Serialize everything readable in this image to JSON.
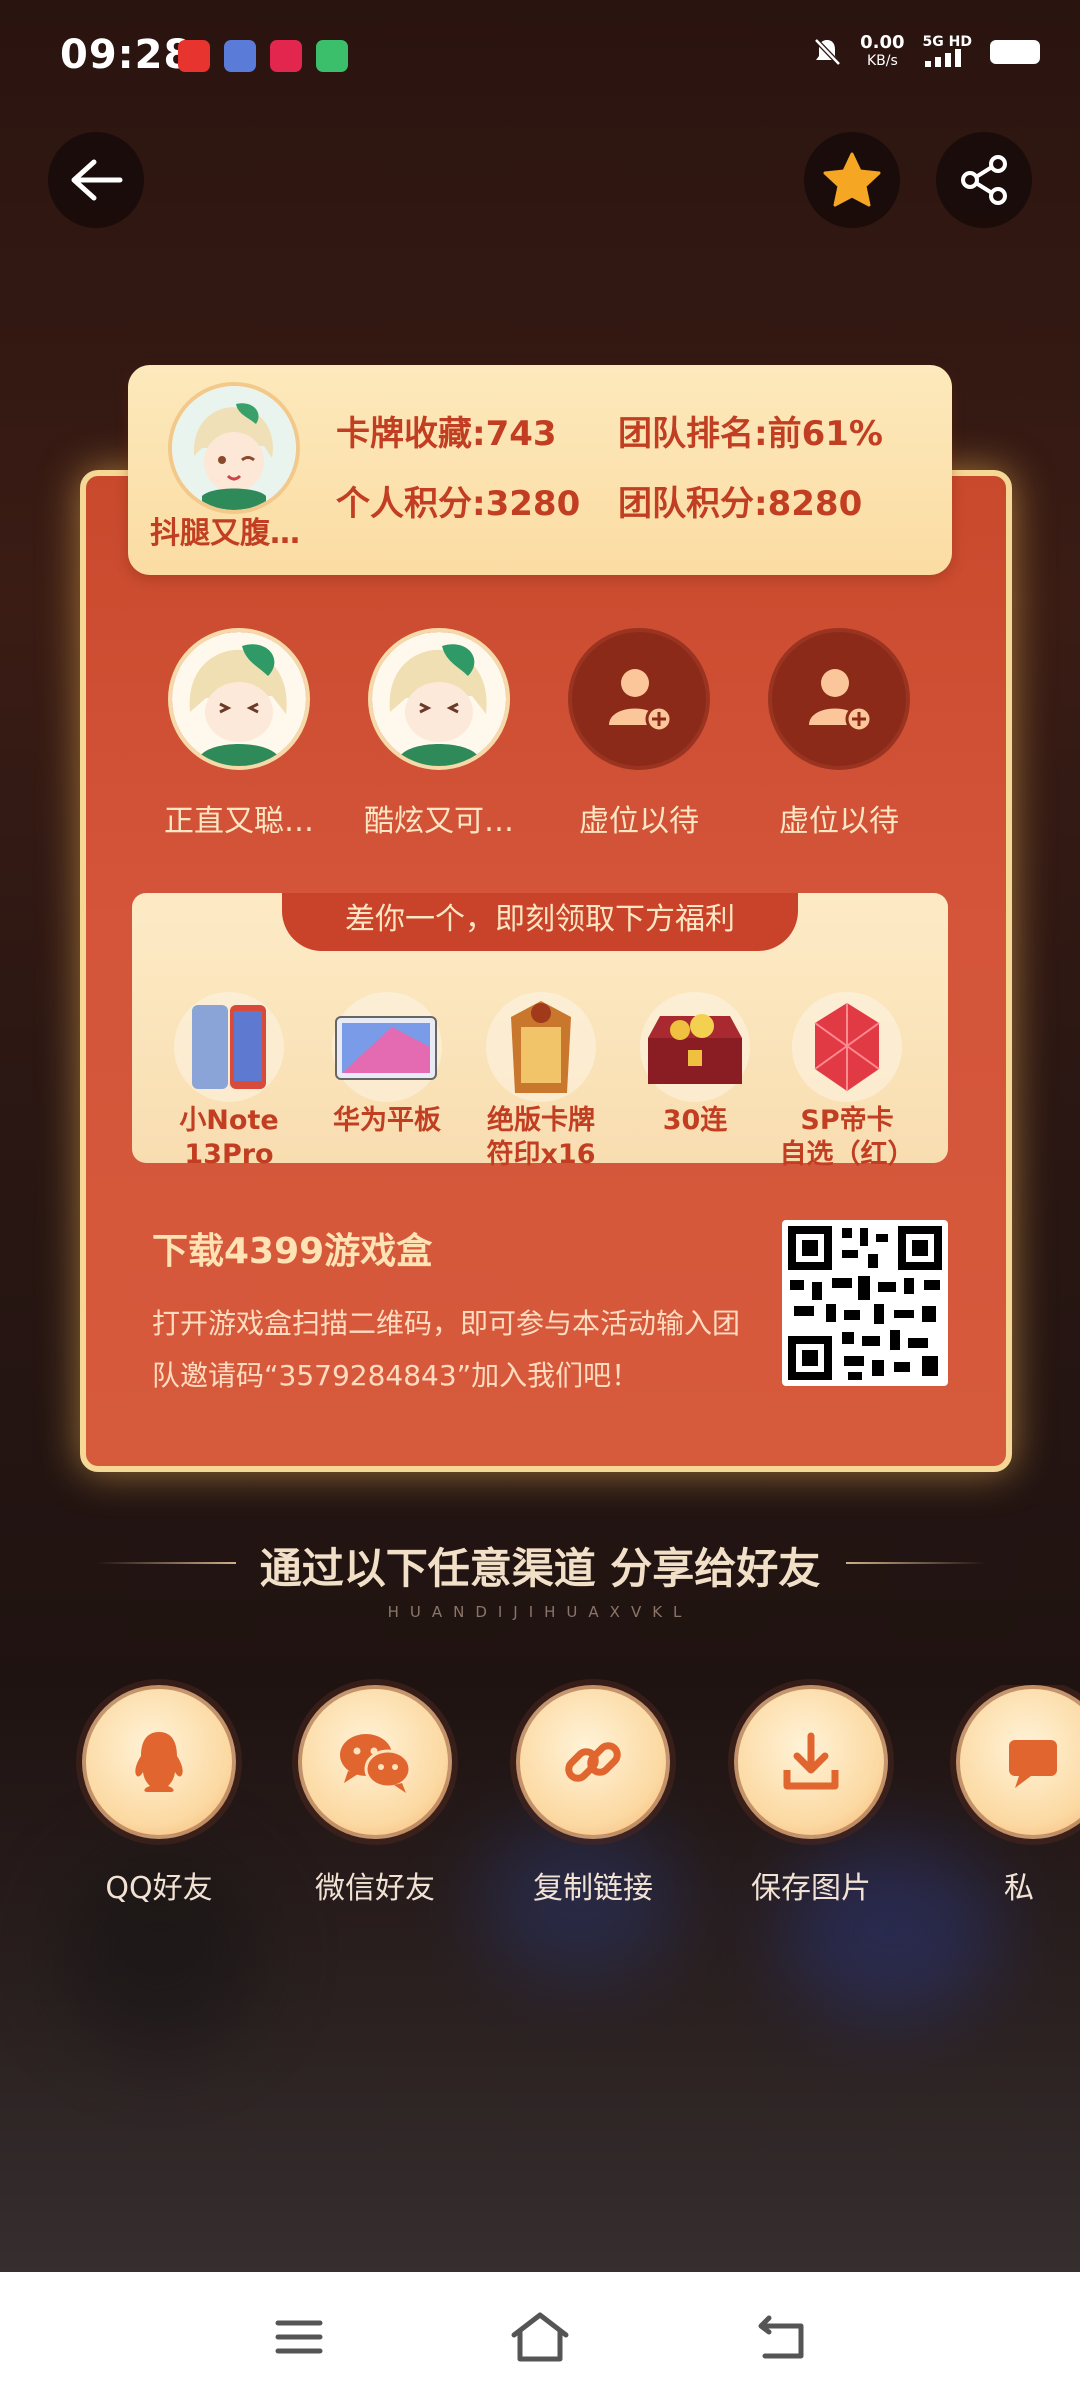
{
  "status_bar": {
    "time": "09:28",
    "net_speed": "0.00",
    "net_unit": "KB/s",
    "signal_label": "5G HD"
  },
  "header": {
    "back_icon": "arrow-left-icon",
    "favorite_icon": "star-icon",
    "share_icon": "share-icon"
  },
  "profile": {
    "username": "抖腿又腹…",
    "card_collection": "卡牌收藏:743",
    "team_rank": "团队排名:前61%",
    "personal_score": "个人积分:3280",
    "team_score": "团队积分:8280"
  },
  "team_members": [
    {
      "name": "正直又聪…",
      "filled": true
    },
    {
      "name": "酷炫又可…",
      "filled": true
    },
    {
      "name": "虚位以待",
      "filled": false
    },
    {
      "name": "虚位以待",
      "filled": false
    }
  ],
  "rewards": {
    "banner": "差你一个，即刻领取下方福利",
    "items": [
      {
        "label": "小Note\n13Pro"
      },
      {
        "label": "华为平板"
      },
      {
        "label": "绝版卡牌\n符印x16"
      },
      {
        "label": "30连"
      },
      {
        "label": "SP帝卡\n自选（红）"
      }
    ]
  },
  "download": {
    "title": "下载4399游戏盒",
    "text": "打开游戏盒扫描二维码，即可参与本活动输入团队邀请码“3579284843”加入我们吧！"
  },
  "share": {
    "title": "通过以下任意渠道  分享给好友",
    "subtitle": "HUANDIJIHUAXVKL",
    "channels": [
      {
        "label": "QQ好友",
        "icon": "qq-penguin-icon"
      },
      {
        "label": "微信好友",
        "icon": "wechat-icon"
      },
      {
        "label": "复制链接",
        "icon": "link-icon"
      },
      {
        "label": "保存图片",
        "icon": "download-icon"
      },
      {
        "label": "私",
        "icon": "message-icon"
      }
    ]
  },
  "colors": {
    "accent_red": "#c23e22",
    "card_red": "#d4553a",
    "cream": "#fde9bc",
    "star": "#f5a623"
  }
}
